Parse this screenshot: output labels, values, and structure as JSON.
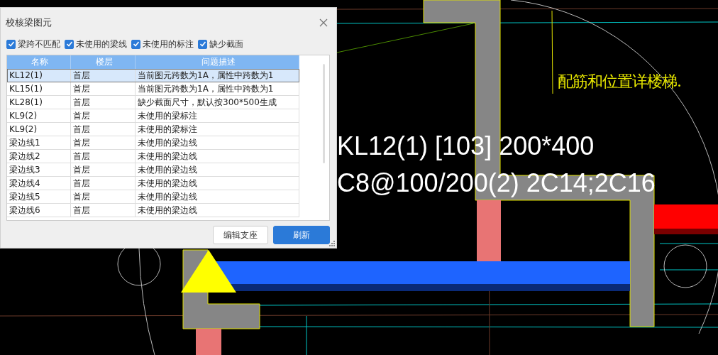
{
  "window": {
    "title": "校核梁图元"
  },
  "filters": [
    {
      "label": "梁跨不匹配",
      "checked": true
    },
    {
      "label": "未使用的梁线",
      "checked": true
    },
    {
      "label": "未使用的标注",
      "checked": true
    },
    {
      "label": "缺少截面",
      "checked": true
    }
  ],
  "table": {
    "columns": [
      "名称",
      "楼层",
      "问题描述"
    ],
    "rows": [
      {
        "cells": [
          "KL12(1)",
          "首层",
          "当前图元跨数为1A，属性中跨数为1"
        ],
        "selected": true
      },
      {
        "cells": [
          "KL15(1)",
          "首层",
          "当前图元跨数为1A，属性中跨数为1"
        ],
        "selected": false
      },
      {
        "cells": [
          "KL28(1)",
          "首层",
          "缺少截面尺寸，默认按300*500生成"
        ],
        "selected": false
      },
      {
        "cells": [
          "KL9(2)",
          "首层",
          "未使用的梁标注"
        ],
        "selected": false
      },
      {
        "cells": [
          "KL9(2)",
          "首层",
          "未使用的梁标注"
        ],
        "selected": false
      },
      {
        "cells": [
          "梁边线1",
          "首层",
          "未使用的梁边线"
        ],
        "selected": false
      },
      {
        "cells": [
          "梁边线2",
          "首层",
          "未使用的梁边线"
        ],
        "selected": false
      },
      {
        "cells": [
          "梁边线3",
          "首层",
          "未使用的梁边线"
        ],
        "selected": false
      },
      {
        "cells": [
          "梁边线4",
          "首层",
          "未使用的梁边线"
        ],
        "selected": false
      },
      {
        "cells": [
          "梁边线5",
          "首层",
          "未使用的梁边线"
        ],
        "selected": false
      },
      {
        "cells": [
          "梁边线6",
          "首层",
          "未使用的梁边线"
        ],
        "selected": false
      }
    ]
  },
  "buttons": [
    {
      "label": "编辑支座",
      "kind": "secondary"
    },
    {
      "label": "刷新",
      "kind": "primary"
    }
  ],
  "canvas": {
    "note": "配筋和位置详楼梯.",
    "beam_label_lines": [
      "KL12(1) [103] 200*400",
      "C8@100/200(2) 2C14;2C16"
    ]
  }
}
